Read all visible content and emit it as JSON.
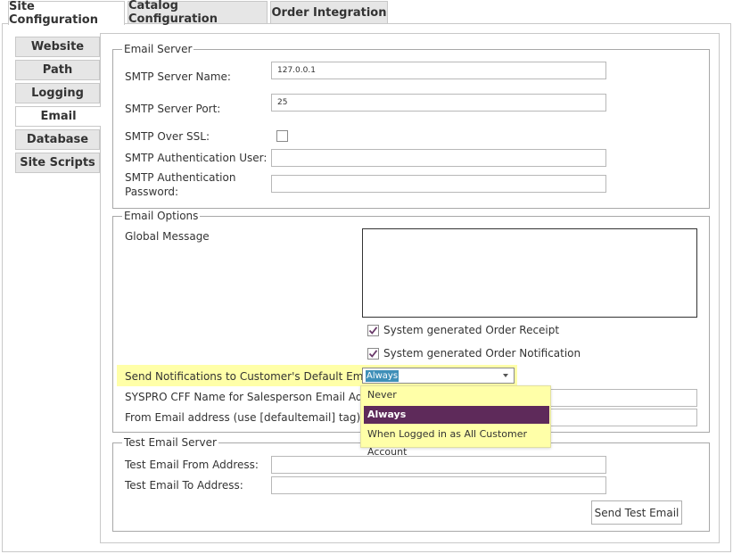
{
  "top_tabs": [
    {
      "label": "Site Configuration",
      "active": true
    },
    {
      "label": "Catalog Configuration",
      "active": false
    },
    {
      "label": "Order Integration",
      "active": false
    }
  ],
  "side_tabs": [
    {
      "label": "Website",
      "active": false
    },
    {
      "label": "Path",
      "active": false
    },
    {
      "label": "Logging",
      "active": false
    },
    {
      "label": "Email",
      "active": true
    },
    {
      "label": "Database",
      "active": false
    },
    {
      "label": "Site Scripts",
      "active": false
    }
  ],
  "email_server": {
    "legend": "Email Server",
    "smtp_server_name_label": "SMTP Server Name:",
    "smtp_server_name_value": "127.0.0.1",
    "smtp_server_port_label": "SMTP Server Port:",
    "smtp_server_port_value": "25",
    "smtp_over_ssl_label": "SMTP Over SSL:",
    "smtp_over_ssl_checked": false,
    "smtp_auth_user_label": "SMTP Authentication User:",
    "smtp_auth_user_value": "",
    "smtp_auth_password_label_1": "SMTP Authentication",
    "smtp_auth_password_label_2": "Password:",
    "smtp_auth_password_value": ""
  },
  "email_options": {
    "legend": "Email Options",
    "global_message_label": "Global Message",
    "order_receipt_label": "System generated Order Receipt",
    "order_receipt_checked": true,
    "order_notification_label": "System generated Order Notification",
    "order_notification_checked": true,
    "send_notifications_label": "Send Notifications to Customer's Default Email",
    "send_notifications_value": "Always",
    "send_notifications_options": [
      "Never",
      "Always",
      "When Logged in as All Customer Account"
    ],
    "syspro_cff_label": "SYSPRO CFF Name for Salesperson Email Address",
    "from_email_label": "From Email address (use [defaultemail] tag)"
  },
  "test_email_server": {
    "legend": "Test Email Server",
    "from_label": "Test Email From Address:",
    "to_label": "Test Email To Address:",
    "send_button": "Send Test Email"
  },
  "colors": {
    "highlight": "#ffffa8",
    "selected_option": "#5e2a5a",
    "selection_text_bg": "#3f8fb8",
    "checkmark": "#6a3a6a"
  }
}
